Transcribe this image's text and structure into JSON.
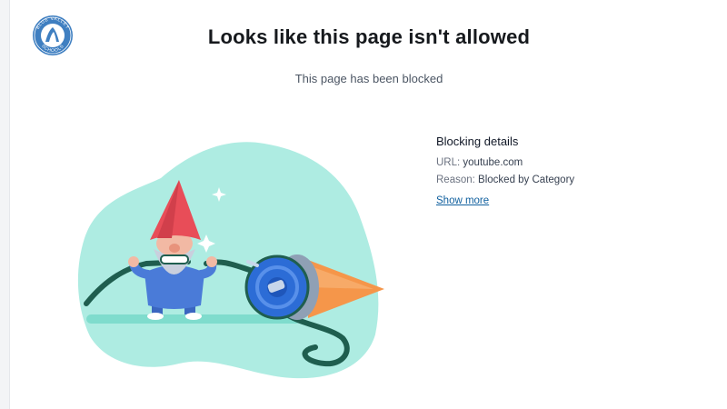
{
  "logo": {
    "text": "BLUE VALLEY SCHOOLS",
    "color": "#3f7fc1"
  },
  "header": {
    "title": "Looks like this page isn't allowed",
    "subtitle": "This page has been blocked"
  },
  "details": {
    "heading": "Blocking details",
    "url_label": "URL:",
    "url_value": "youtube.com",
    "reason_label": "Reason:",
    "reason_value": "Blocked by Category",
    "show_more": "Show more"
  },
  "colors": {
    "blob": "#aeece2",
    "ground": "#7fdccd",
    "cable": "#1f5e4f",
    "gnome_hat": "#e84d58",
    "gnome_body": "#4a7bd8",
    "beard": "#c9cfdd",
    "spool": "#2c6cd6",
    "cone": "#f5964a",
    "link": "#0f5f9e"
  },
  "illustration": {
    "name": "gnome-cutting-cable"
  }
}
